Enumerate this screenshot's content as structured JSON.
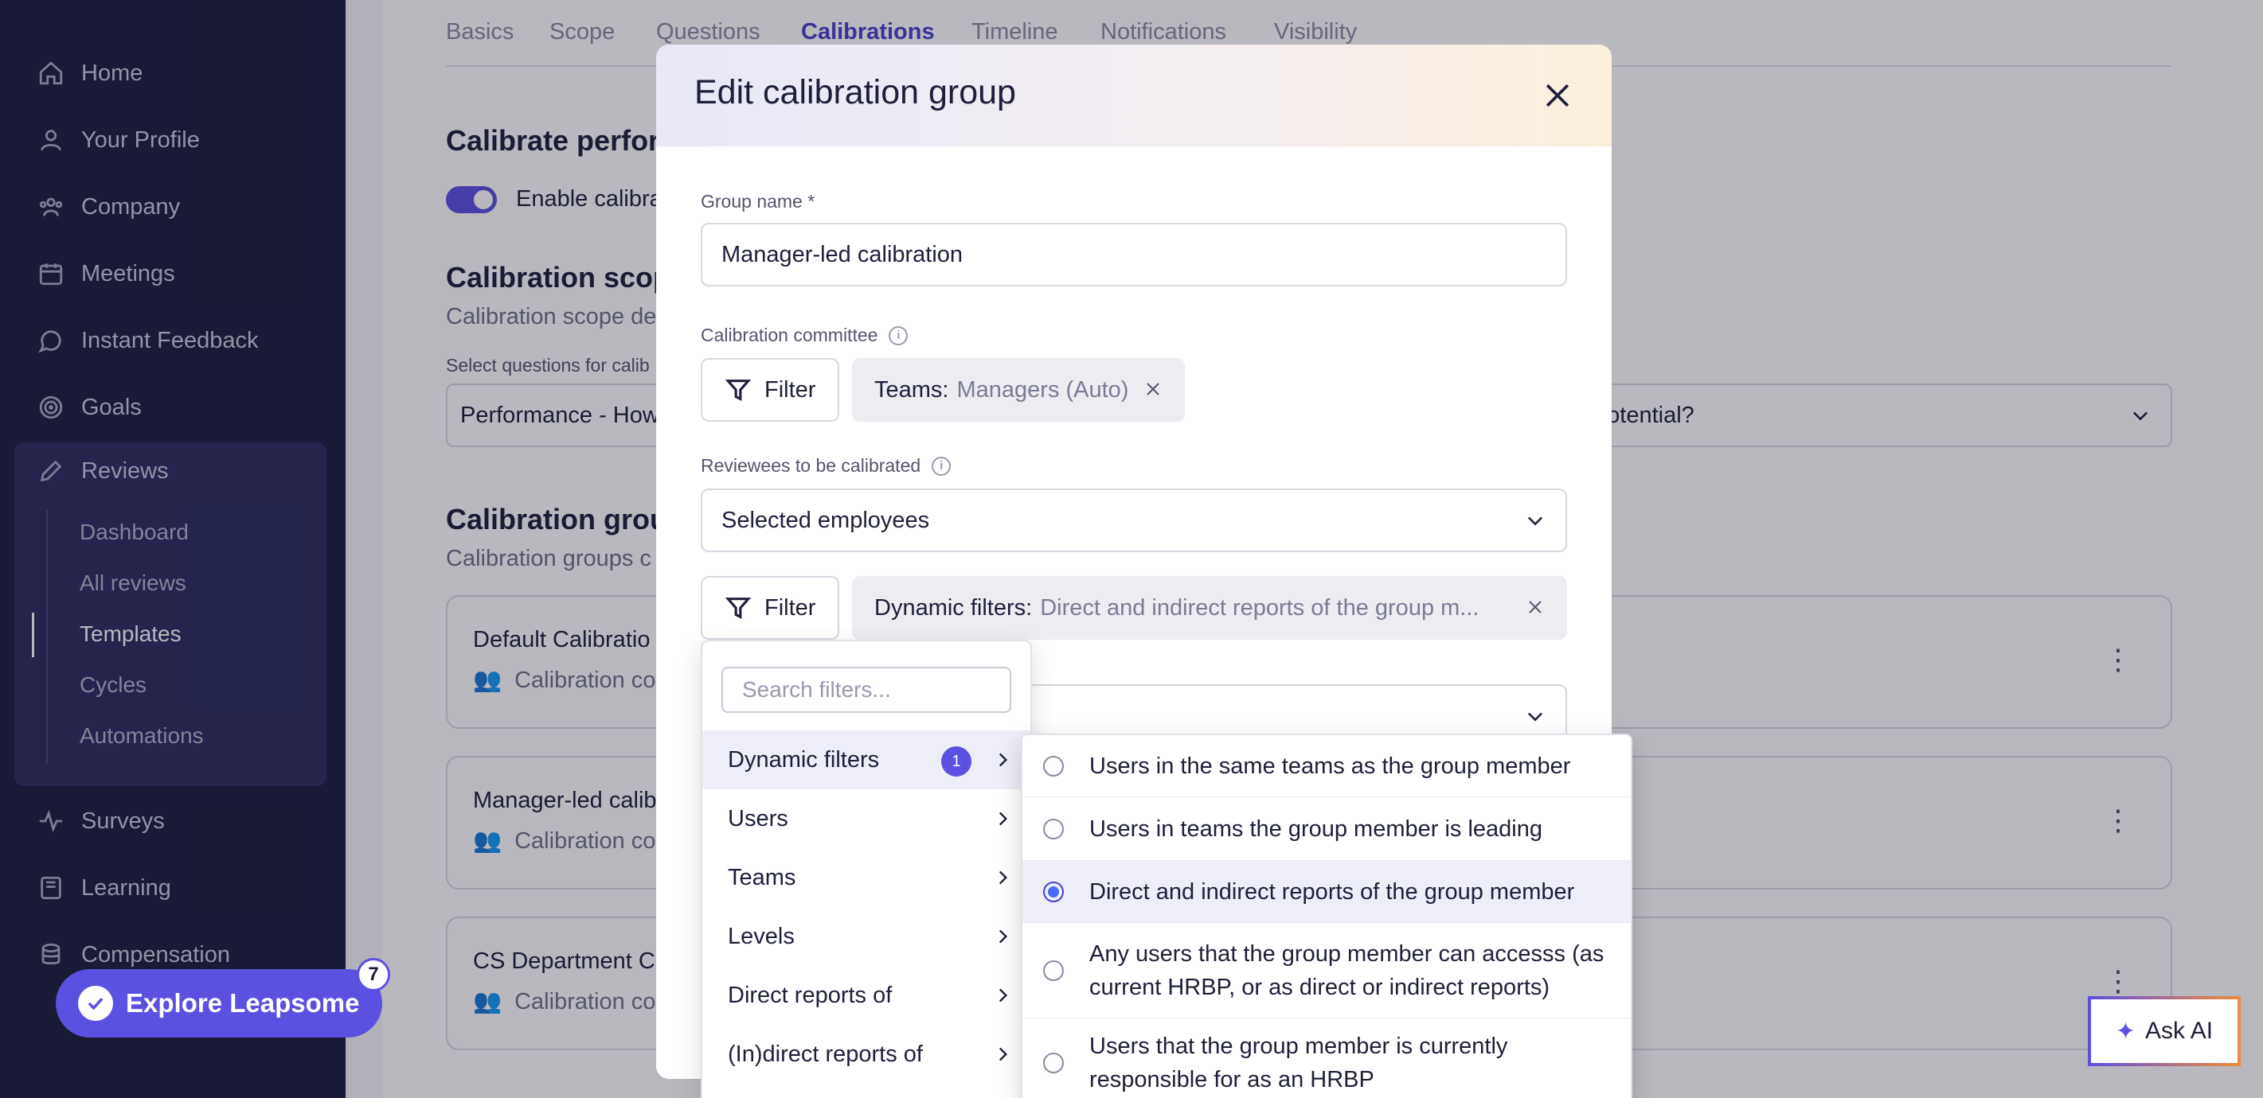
{
  "sidebar": {
    "items": [
      {
        "label": "Home",
        "icon": "home-icon"
      },
      {
        "label": "Your Profile",
        "icon": "user-icon"
      },
      {
        "label": "Company",
        "icon": "people-icon"
      },
      {
        "label": "Meetings",
        "icon": "calendar-icon"
      },
      {
        "label": "Instant Feedback",
        "icon": "chat-icon"
      },
      {
        "label": "Goals",
        "icon": "target-icon"
      },
      {
        "label": "Reviews",
        "icon": "pencil-icon"
      },
      {
        "label": "Surveys",
        "icon": "pulse-icon"
      },
      {
        "label": "Learning",
        "icon": "book-icon"
      },
      {
        "label": "Compensation",
        "icon": "coins-icon"
      }
    ],
    "review_sub_items": [
      "Dashboard",
      "All reviews",
      "Templates",
      "Cycles",
      "Automations"
    ],
    "active_sub_item": "Templates",
    "explore_label": "Explore Leapsome",
    "explore_badge": "7"
  },
  "tabs": [
    "Basics",
    "Scope",
    "Questions",
    "Calibrations",
    "Timeline",
    "Notifications",
    "Visibility"
  ],
  "active_tab": "Calibrations",
  "background": {
    "calibrate_heading": "Calibrate perfor",
    "enable_label": "Enable calibra",
    "scope_heading": "Calibration scop",
    "scope_desc": "Calibration scope de",
    "select_questions_label": "Select questions for calib",
    "select_value_left": "Performance - How",
    "select_value_right": "potential?",
    "groups_heading": "Calibration grou",
    "groups_desc": "Calibration groups c",
    "cards": [
      {
        "title": "Default Calibratio",
        "sub": "Calibration co"
      },
      {
        "title": "Manager-led calib",
        "sub": "Calibration co"
      },
      {
        "title": "CS Department C",
        "sub": "Calibration co"
      }
    ]
  },
  "modal": {
    "title": "Edit calibration group",
    "group_name_label": "Group name *",
    "group_name_value": "Manager-led calibration",
    "committee_label": "Calibration committee",
    "filter_label": "Filter",
    "committee_chip_key": "Teams:",
    "committee_chip_value": "Managers (Auto)",
    "reviewees_label": "Reviewees to be calibrated",
    "reviewees_value": "Selected employees",
    "dynamic_chip_key": "Dynamic filters:",
    "dynamic_chip_value": "Direct and indirect reports of the group m..."
  },
  "filter_menu": {
    "search_placeholder": "Search filters...",
    "items": [
      "Dynamic filters",
      "Users",
      "Teams",
      "Levels",
      "Direct reports of",
      "(In)direct reports of"
    ],
    "dynamic_badge": "1"
  },
  "dynamic_options": [
    "Users in the same teams as the group member",
    "Users in teams the group member is leading",
    "Direct and indirect reports of the group member",
    "Any users that the group member can accesss (as current HRBP, or as direct or indirect reports)",
    "Users that the group member is currently responsible for as an HRBP"
  ],
  "selected_option": "Direct and indirect reports of the group member",
  "ask_ai_label": "Ask AI",
  "colors": {
    "accent": "#5c50e0",
    "sidebar": "#1c1d3b"
  }
}
